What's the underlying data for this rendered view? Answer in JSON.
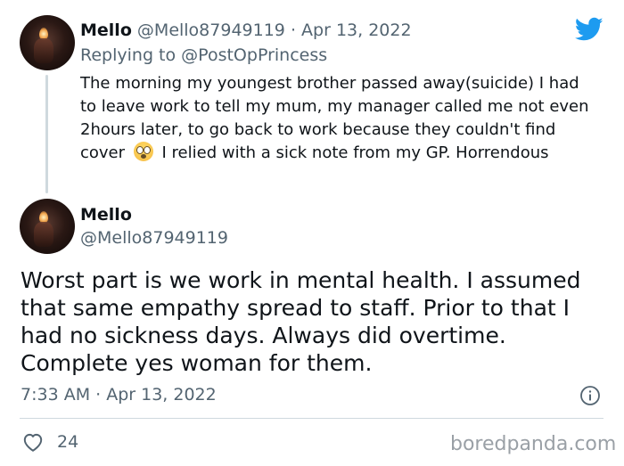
{
  "reply_tweet": {
    "display_name": "Mello",
    "handle": "@Mello87949119",
    "separator": "·",
    "date": "Apr 13, 2022",
    "replying_prefix": "Replying to",
    "replying_handle": "@PostOpPrincess",
    "text_before_emoji": "The morning my youngest brother passed away(suicide) I had to leave work to tell my mum, my manager called me not even 2hours later, to go back to work because they couldn't find cover",
    "emoji": "flushed-face-emoji",
    "text_after_emoji": "I relied with a sick note from my GP. Horrendous"
  },
  "main_tweet": {
    "display_name": "Mello",
    "handle": "@Mello87949119",
    "text": "Worst part is we work in mental health. I assumed that same empathy spread to staff. Prior to that I had no sickness days. Always did overtime. Complete yes woman for them.",
    "timestamp": "7:33 AM · Apr 13, 2022",
    "like_count": "24"
  },
  "icons": {
    "brand": "twitter-bird-icon",
    "info": "info-icon",
    "like": "heart-icon"
  },
  "watermark": "boredpanda.com",
  "colors": {
    "twitter_blue": "#1d9bf0",
    "text_primary": "#0f1419",
    "text_secondary": "#536471",
    "divider": "#cfd9de"
  }
}
